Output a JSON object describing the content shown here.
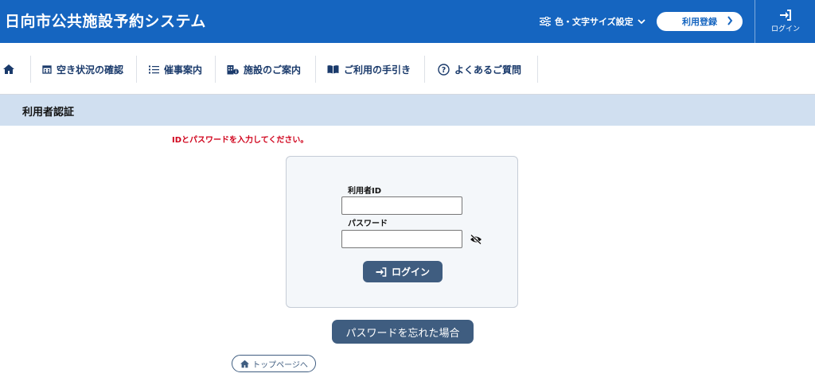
{
  "header": {
    "title": "日向市公共施設予約システム",
    "color_setting_label": "色・文字サイズ設定",
    "register_label": "利用登録",
    "login_label": "ログイン"
  },
  "nav": {
    "items": [
      {
        "label": "",
        "icon": "home-icon"
      },
      {
        "label": "空き状況の確認",
        "icon": "calendar-icon"
      },
      {
        "label": "催事案内",
        "icon": "list-icon"
      },
      {
        "label": "施設のご案内",
        "icon": "building-info-icon"
      },
      {
        "label": "ご利用の手引き",
        "icon": "book-icon"
      },
      {
        "label": "よくあるご質問",
        "icon": "question-icon"
      }
    ]
  },
  "section": {
    "title": "利用者認証"
  },
  "message": "IDとパスワードを入力してください。",
  "form": {
    "user_id_label": "利用者ID",
    "user_id_value": "",
    "password_label": "パスワード",
    "password_value": "",
    "login_button": "ログイン"
  },
  "forgot_password_button": "パスワードを忘れた場合",
  "top_page_link": "トップページへ",
  "colors": {
    "header_bg": "#1565c0",
    "nav_text": "#1a3a6b",
    "section_bg": "#d0dff0",
    "error_text": "#d0021b",
    "button_bg": "#3f5d80"
  }
}
